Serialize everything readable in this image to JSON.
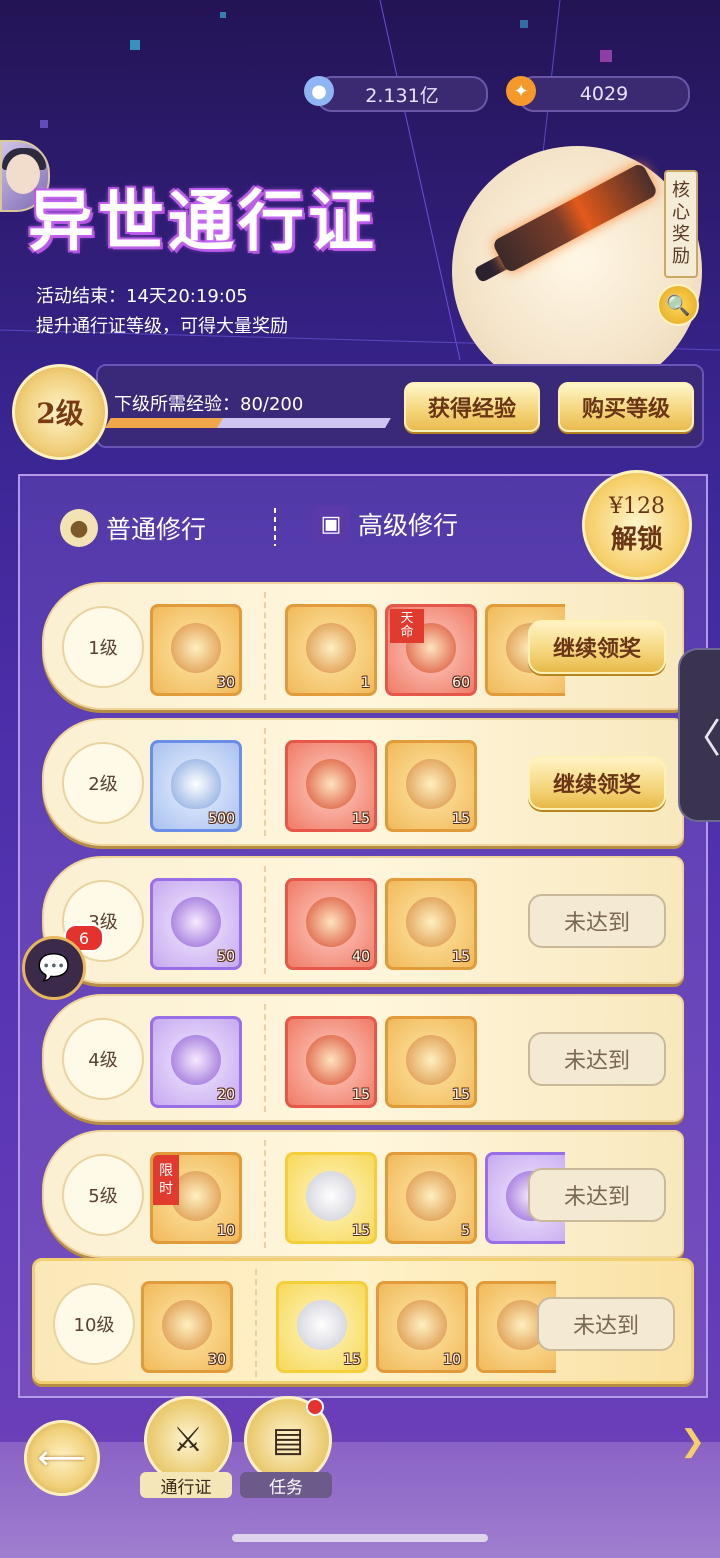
{
  "currency": {
    "diamond": {
      "icon": "crystal-drop-icon",
      "value": "2.131亿"
    },
    "flame": {
      "icon": "flame-icon",
      "value": "4029"
    }
  },
  "header": {
    "title": "异世通行证",
    "event_end": "活动结束：14天20:19:05",
    "hint": "提升通行证等级，可得大量奖励",
    "core_reward_tag": [
      "核",
      "心",
      "奖",
      "励"
    ]
  },
  "level": {
    "current": "2级",
    "exp_label": "下级所需经验：80/200",
    "exp_progress": 0.4,
    "get_exp_button": "获得经验",
    "buy_level_button": "购买等级"
  },
  "tabs": {
    "normal": "普通修行",
    "advanced": "高级修行",
    "unlock_price": "¥128",
    "unlock_label": "解锁"
  },
  "rows": [
    {
      "level": "1级",
      "normal": {
        "style": "orange",
        "count": "30"
      },
      "advanced": [
        {
          "style": "orange",
          "count": "1"
        },
        {
          "style": "red",
          "count": "60",
          "tag": "天命"
        },
        {
          "style": "orange",
          "count": ""
        }
      ],
      "action": "继续领奖",
      "state": "claim"
    },
    {
      "level": "2级",
      "normal": {
        "style": "blue",
        "count": "500"
      },
      "advanced": [
        {
          "style": "red",
          "count": "15"
        },
        {
          "style": "orange",
          "count": "15"
        }
      ],
      "action": "继续领奖",
      "state": "claim"
    },
    {
      "level": "3级",
      "normal": {
        "style": "purple",
        "count": "50"
      },
      "advanced": [
        {
          "style": "red",
          "count": "40"
        },
        {
          "style": "orange",
          "count": "15"
        }
      ],
      "action": "未达到",
      "state": "locked",
      "badge": "6"
    },
    {
      "level": "4级",
      "normal": {
        "style": "purple",
        "count": "20"
      },
      "advanced": [
        {
          "style": "red",
          "count": "15"
        },
        {
          "style": "orange",
          "count": "15"
        }
      ],
      "action": "未达到",
      "state": "locked"
    },
    {
      "level": "5级",
      "normal": {
        "style": "orange",
        "count": "10",
        "tag": "限时"
      },
      "advanced": [
        {
          "style": "gold",
          "count": "15"
        },
        {
          "style": "orange",
          "count": "5"
        },
        {
          "style": "purple",
          "count": ""
        }
      ],
      "action": "未达到",
      "state": "locked"
    },
    {
      "level": "10级",
      "normal": {
        "style": "orange",
        "count": "30"
      },
      "advanced": [
        {
          "style": "gold",
          "count": "15"
        },
        {
          "style": "orange",
          "count": "10"
        },
        {
          "style": "orange",
          "count": ""
        }
      ],
      "action": "未达到",
      "state": "locked",
      "highlight": true
    }
  ],
  "nav": {
    "pass": "通行证",
    "task": "任务"
  },
  "icons": {
    "magnify": "🔍",
    "chat": "💬",
    "back": "⟵",
    "side_handle": "〈",
    "next": "❯"
  }
}
